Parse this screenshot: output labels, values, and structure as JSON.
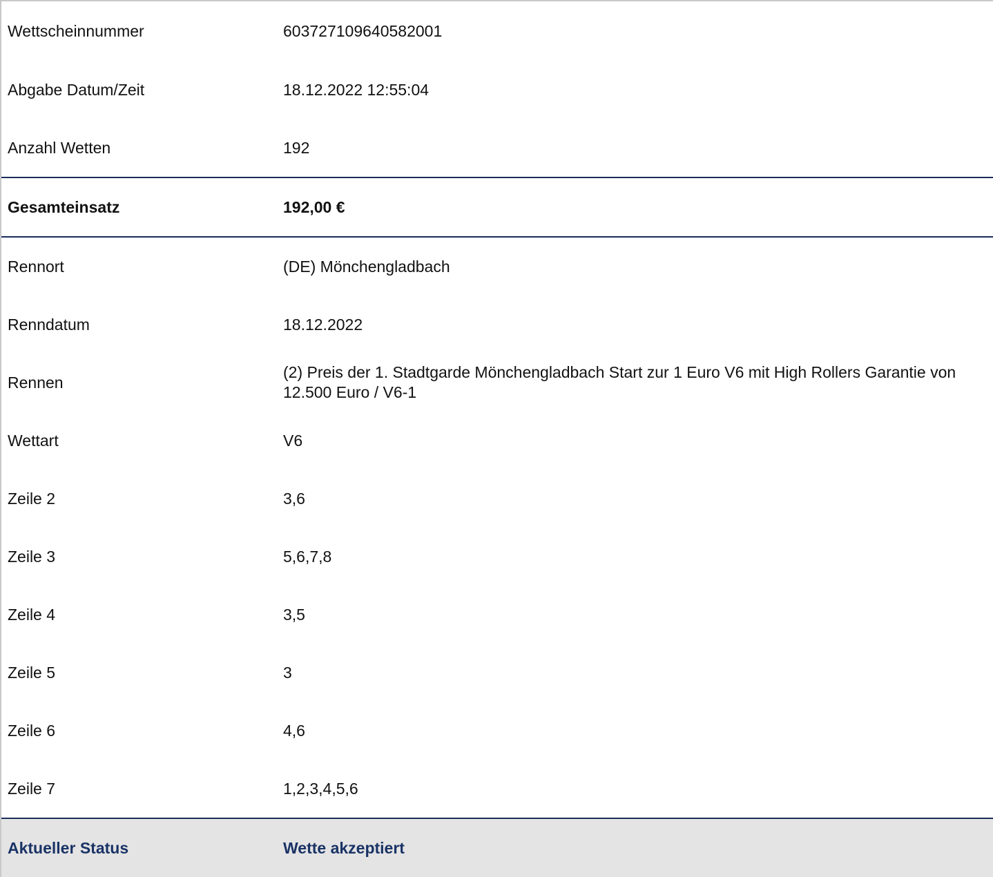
{
  "ticket": {
    "rows": [
      {
        "label": "Wettscheinnummer",
        "value": "603727109640582001"
      },
      {
        "label": "Abgabe Datum/Zeit",
        "value": "18.12.2022 12:55:04"
      },
      {
        "label": "Anzahl Wetten",
        "value": "192"
      }
    ],
    "total": {
      "label": "Gesamteinsatz",
      "value": "192,00 €"
    },
    "race_rows": [
      {
        "label": "Rennort",
        "value": "(DE) Mönchengladbach"
      },
      {
        "label": "Renndatum",
        "value": "18.12.2022"
      },
      {
        "label": "Rennen",
        "value": "(2) Preis der 1. Stadtgarde Mönchengladbach Start zur 1 Euro V6 mit High Rollers Garantie von 12.500 Euro / V6-1"
      },
      {
        "label": "Wettart",
        "value": "V6"
      },
      {
        "label": "Zeile 2",
        "value": "3,6"
      },
      {
        "label": "Zeile 3",
        "value": "5,6,7,8"
      },
      {
        "label": "Zeile 4",
        "value": "3,5"
      },
      {
        "label": "Zeile 5",
        "value": "3"
      },
      {
        "label": "Zeile 6",
        "value": "4,6"
      },
      {
        "label": "Zeile 7",
        "value": "1,2,3,4,5,6"
      }
    ],
    "status": {
      "label": "Aktueller Status",
      "value": "Wette akzeptiert"
    }
  },
  "colors": {
    "divider": "#1a2d5a",
    "status_text": "#1a3366",
    "status_background": "#e4e4e4"
  }
}
